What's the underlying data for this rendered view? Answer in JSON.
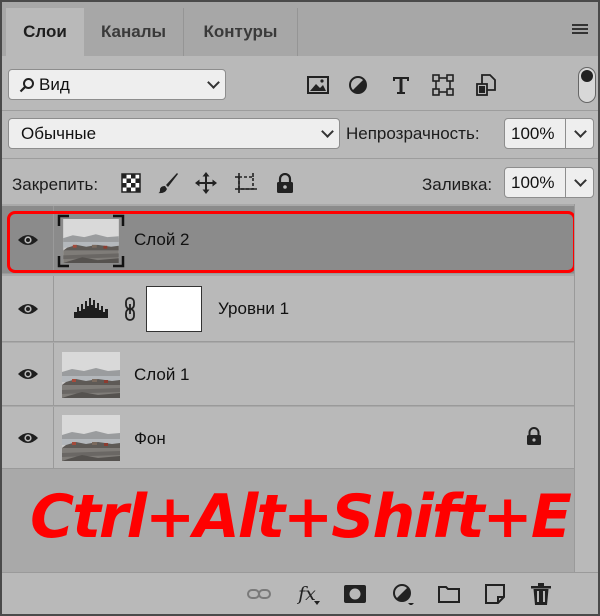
{
  "tabs": [
    {
      "label": "Слои",
      "active": true
    },
    {
      "label": "Каналы",
      "active": false
    },
    {
      "label": "Контуры",
      "active": false
    }
  ],
  "filter": {
    "kind_label": "Вид"
  },
  "blend": {
    "mode": "Обычные",
    "opacity_label": "Непрозрачность:",
    "opacity_value": "100%"
  },
  "lock": {
    "label": "Закрепить:",
    "fill_label": "Заливка:",
    "fill_value": "100%"
  },
  "layers": [
    {
      "name": "Слой 2",
      "selected": true
    },
    {
      "name": "Уровни 1",
      "type": "adjustment"
    },
    {
      "name": "Слой 1"
    },
    {
      "name": "Фон",
      "locked": true
    }
  ],
  "overlay": {
    "shortcut": "Ctrl+Alt+Shift+E",
    "color": "#ff0000"
  },
  "bottom_toolbar": {
    "fx_label": "fx"
  },
  "colors": {
    "panel_bg": "#b9b9b9",
    "selected_row": "#8b8b8b",
    "highlight": "#ff0000"
  }
}
